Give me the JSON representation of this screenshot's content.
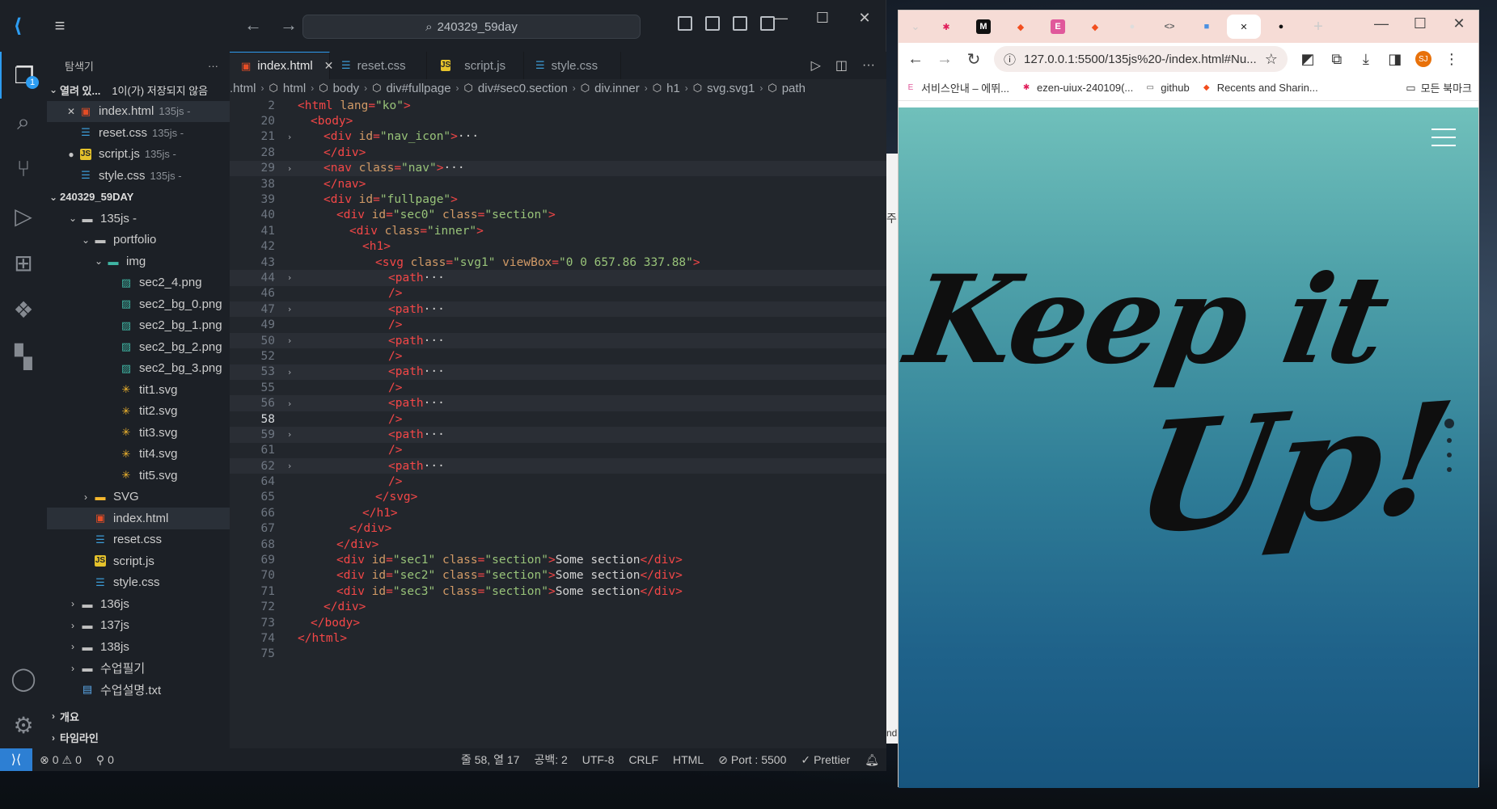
{
  "vscode": {
    "search_text": "240329_59day",
    "explorer_title": "탐색기",
    "explorer_more": "···",
    "open_editors": {
      "label": "열려 있...",
      "unsaved_note": "1이(가) 저장되지 않음",
      "files": [
        {
          "name": "index.html",
          "folder": "135js -",
          "icon": "html"
        },
        {
          "name": "reset.css",
          "folder": "135js -",
          "icon": "css"
        },
        {
          "name": "script.js",
          "folder": "135js -",
          "icon": "js"
        },
        {
          "name": "style.css",
          "folder": "135js -",
          "icon": "css"
        }
      ]
    },
    "workspace": {
      "label": "240329_59DAY",
      "tree": [
        {
          "name": "135js -",
          "type": "folder-open",
          "indent": 1
        },
        {
          "name": "portfolio",
          "type": "folder-open",
          "indent": 2
        },
        {
          "name": "img",
          "type": "img-folder",
          "indent": 3
        },
        {
          "name": "sec2_4.png",
          "type": "img",
          "indent": 4
        },
        {
          "name": "sec2_bg_0.png",
          "type": "img",
          "indent": 4
        },
        {
          "name": "sec2_bg_1.png",
          "type": "img",
          "indent": 4
        },
        {
          "name": "sec2_bg_2.png",
          "type": "img",
          "indent": 4
        },
        {
          "name": "sec2_bg_3.png",
          "type": "img",
          "indent": 4
        },
        {
          "name": "tit1.svg",
          "type": "svg",
          "indent": 4
        },
        {
          "name": "tit2.svg",
          "type": "svg",
          "indent": 4
        },
        {
          "name": "tit3.svg",
          "type": "svg",
          "indent": 4
        },
        {
          "name": "tit4.svg",
          "type": "svg",
          "indent": 4
        },
        {
          "name": "tit5.svg",
          "type": "svg",
          "indent": 4
        },
        {
          "name": "SVG",
          "type": "svg-folder",
          "indent": 2
        },
        {
          "name": "index.html",
          "type": "html",
          "indent": 2
        },
        {
          "name": "reset.css",
          "type": "css",
          "indent": 2
        },
        {
          "name": "script.js",
          "type": "js",
          "indent": 2
        },
        {
          "name": "style.css",
          "type": "css",
          "indent": 2
        },
        {
          "name": "136js",
          "type": "folder",
          "indent": 1
        },
        {
          "name": "137js",
          "type": "folder",
          "indent": 1
        },
        {
          "name": "138js",
          "type": "folder",
          "indent": 1
        },
        {
          "name": "수업필기",
          "type": "folder",
          "indent": 1
        },
        {
          "name": "수업설명.txt",
          "type": "txt",
          "indent": 1
        }
      ]
    },
    "outline_label": "개요",
    "timeline_label": "타임라인",
    "tabs": [
      {
        "label": "index.html",
        "icon": "html",
        "state": "active"
      },
      {
        "label": "reset.css",
        "icon": "css",
        "state": ""
      },
      {
        "label": "script.js",
        "icon": "js",
        "state": "modified"
      },
      {
        "label": "style.css",
        "icon": "css",
        "state": ""
      }
    ],
    "breadcrumb": [
      ".html",
      "html",
      "body",
      "div#fullpage",
      "div#sec0.section",
      "div.inner",
      "h1",
      "svg.svg1",
      "path"
    ],
    "code_lines": [
      {
        "n": "2",
        "fold": "",
        "indent": 0,
        "parts": [
          [
            "t-tag",
            "<html "
          ],
          [
            "t-attr",
            "lang"
          ],
          [
            "t-tag",
            "="
          ],
          [
            "t-str",
            "\"ko\""
          ],
          [
            "t-tag",
            ">"
          ]
        ]
      },
      {
        "n": "20",
        "fold": "",
        "indent": 1,
        "parts": [
          [
            "t-tag",
            "<body>"
          ]
        ]
      },
      {
        "n": "21",
        "fold": ">",
        "indent": 2,
        "parts": [
          [
            "t-tag",
            "<div "
          ],
          [
            "t-attr",
            "id"
          ],
          [
            "t-tag",
            "="
          ],
          [
            "t-str",
            "\"nav_icon\""
          ],
          [
            "t-tag",
            ">"
          ],
          [
            "t-txt",
            "···"
          ]
        ]
      },
      {
        "n": "28",
        "fold": "",
        "indent": 2,
        "parts": [
          [
            "t-tag",
            "</div>"
          ]
        ]
      },
      {
        "n": "29",
        "fold": ">",
        "indent": 2,
        "parts": [
          [
            "t-tag",
            "<nav "
          ],
          [
            "t-attr",
            "class"
          ],
          [
            "t-tag",
            "="
          ],
          [
            "t-str",
            "\"nav\""
          ],
          [
            "t-tag",
            ">"
          ],
          [
            "t-txt",
            "···"
          ]
        ],
        "hl": true
      },
      {
        "n": "38",
        "fold": "",
        "indent": 2,
        "parts": [
          [
            "t-tag",
            "</nav>"
          ]
        ]
      },
      {
        "n": "39",
        "fold": "",
        "indent": 2,
        "parts": [
          [
            "t-tag",
            "<div "
          ],
          [
            "t-attr",
            "id"
          ],
          [
            "t-tag",
            "="
          ],
          [
            "t-str",
            "\"fullpage\""
          ],
          [
            "t-tag",
            ">"
          ]
        ]
      },
      {
        "n": "40",
        "fold": "",
        "indent": 3,
        "parts": [
          [
            "t-tag",
            "<div "
          ],
          [
            "t-attr",
            "id"
          ],
          [
            "t-tag",
            "="
          ],
          [
            "t-str",
            "\"sec0\""
          ],
          [
            "t-txt",
            " "
          ],
          [
            "t-attr",
            "class"
          ],
          [
            "t-tag",
            "="
          ],
          [
            "t-str",
            "\"section\""
          ],
          [
            "t-tag",
            ">"
          ]
        ]
      },
      {
        "n": "41",
        "fold": "",
        "indent": 4,
        "parts": [
          [
            "t-tag",
            "<div "
          ],
          [
            "t-attr",
            "class"
          ],
          [
            "t-tag",
            "="
          ],
          [
            "t-str",
            "\"inner\""
          ],
          [
            "t-tag",
            ">"
          ]
        ]
      },
      {
        "n": "42",
        "fold": "",
        "indent": 5,
        "parts": [
          [
            "t-tag",
            "<h1>"
          ]
        ]
      },
      {
        "n": "43",
        "fold": "",
        "indent": 6,
        "parts": [
          [
            "t-tag",
            "<svg "
          ],
          [
            "t-attr",
            "class"
          ],
          [
            "t-tag",
            "="
          ],
          [
            "t-str",
            "\"svg1\""
          ],
          [
            "t-txt",
            " "
          ],
          [
            "t-attr",
            "viewBox"
          ],
          [
            "t-tag",
            "="
          ],
          [
            "t-str",
            "\"0 0 657.86 337.88\""
          ],
          [
            "t-tag",
            ">"
          ]
        ]
      },
      {
        "n": "44",
        "fold": ">",
        "indent": 7,
        "parts": [
          [
            "t-tag",
            "<path"
          ],
          [
            "t-txt",
            "···"
          ]
        ],
        "hl": true
      },
      {
        "n": "46",
        "fold": "",
        "indent": 7,
        "parts": [
          [
            "t-tag",
            "/>"
          ]
        ]
      },
      {
        "n": "47",
        "fold": ">",
        "indent": 7,
        "parts": [
          [
            "t-tag",
            "<path"
          ],
          [
            "t-txt",
            "···"
          ]
        ],
        "hl": true
      },
      {
        "n": "49",
        "fold": "",
        "indent": 7,
        "parts": [
          [
            "t-tag",
            "/>"
          ]
        ]
      },
      {
        "n": "50",
        "fold": ">",
        "indent": 7,
        "parts": [
          [
            "t-tag",
            "<path"
          ],
          [
            "t-txt",
            "···"
          ]
        ],
        "hl": true
      },
      {
        "n": "52",
        "fold": "",
        "indent": 7,
        "parts": [
          [
            "t-tag",
            "/>"
          ]
        ]
      },
      {
        "n": "53",
        "fold": ">",
        "indent": 7,
        "parts": [
          [
            "t-tag",
            "<path"
          ],
          [
            "t-txt",
            "···"
          ]
        ],
        "hl": true
      },
      {
        "n": "55",
        "fold": "",
        "indent": 7,
        "parts": [
          [
            "t-tag",
            "/>"
          ]
        ]
      },
      {
        "n": "56",
        "fold": ">",
        "indent": 7,
        "parts": [
          [
            "t-tag",
            "<path"
          ],
          [
            "t-txt",
            "···"
          ]
        ],
        "hl": true
      },
      {
        "n": "58",
        "fold": "",
        "indent": 7,
        "parts": [
          [
            "t-tag",
            "/>"
          ]
        ],
        "current": true
      },
      {
        "n": "59",
        "fold": ">",
        "indent": 7,
        "parts": [
          [
            "t-tag",
            "<path"
          ],
          [
            "t-txt",
            "···"
          ]
        ],
        "hl": true
      },
      {
        "n": "61",
        "fold": "",
        "indent": 7,
        "parts": [
          [
            "t-tag",
            "/>"
          ]
        ]
      },
      {
        "n": "62",
        "fold": ">",
        "indent": 7,
        "parts": [
          [
            "t-tag",
            "<path"
          ],
          [
            "t-txt",
            "···"
          ]
        ],
        "hl": true
      },
      {
        "n": "64",
        "fold": "",
        "indent": 7,
        "parts": [
          [
            "t-tag",
            "/>"
          ]
        ]
      },
      {
        "n": "65",
        "fold": "",
        "indent": 6,
        "parts": [
          [
            "t-tag",
            "</svg>"
          ]
        ]
      },
      {
        "n": "66",
        "fold": "",
        "indent": 5,
        "parts": [
          [
            "t-tag",
            "</h1>"
          ]
        ]
      },
      {
        "n": "67",
        "fold": "",
        "indent": 4,
        "parts": [
          [
            "t-tag",
            "</div>"
          ]
        ]
      },
      {
        "n": "68",
        "fold": "",
        "indent": 3,
        "parts": [
          [
            "t-tag",
            "</div>"
          ]
        ]
      },
      {
        "n": "69",
        "fold": "",
        "indent": 3,
        "parts": [
          [
            "t-tag",
            "<div "
          ],
          [
            "t-attr",
            "id"
          ],
          [
            "t-tag",
            "="
          ],
          [
            "t-str",
            "\"sec1\""
          ],
          [
            "t-txt",
            " "
          ],
          [
            "t-attr",
            "class"
          ],
          [
            "t-tag",
            "="
          ],
          [
            "t-str",
            "\"section\""
          ],
          [
            "t-tag",
            ">"
          ],
          [
            "t-txt",
            "Some section"
          ],
          [
            "t-tag",
            "</div>"
          ]
        ]
      },
      {
        "n": "70",
        "fold": "",
        "indent": 3,
        "parts": [
          [
            "t-tag",
            "<div "
          ],
          [
            "t-attr",
            "id"
          ],
          [
            "t-tag",
            "="
          ],
          [
            "t-str",
            "\"sec2\""
          ],
          [
            "t-txt",
            " "
          ],
          [
            "t-attr",
            "class"
          ],
          [
            "t-tag",
            "="
          ],
          [
            "t-str",
            "\"section\""
          ],
          [
            "t-tag",
            ">"
          ],
          [
            "t-txt",
            "Some section"
          ],
          [
            "t-tag",
            "</div>"
          ]
        ]
      },
      {
        "n": "71",
        "fold": "",
        "indent": 3,
        "parts": [
          [
            "t-tag",
            "<div "
          ],
          [
            "t-attr",
            "id"
          ],
          [
            "t-tag",
            "="
          ],
          [
            "t-str",
            "\"sec3\""
          ],
          [
            "t-txt",
            " "
          ],
          [
            "t-attr",
            "class"
          ],
          [
            "t-tag",
            "="
          ],
          [
            "t-str",
            "\"section\""
          ],
          [
            "t-tag",
            ">"
          ],
          [
            "t-txt",
            "Some section"
          ],
          [
            "t-tag",
            "</div>"
          ]
        ]
      },
      {
        "n": "72",
        "fold": "",
        "indent": 2,
        "parts": [
          [
            "t-tag",
            "</div>"
          ]
        ]
      },
      {
        "n": "73",
        "fold": "",
        "indent": 1,
        "parts": [
          [
            "t-tag",
            "</body>"
          ]
        ]
      },
      {
        "n": "74",
        "fold": "",
        "indent": 0,
        "parts": [
          [
            "t-tag",
            "</html>"
          ]
        ]
      },
      {
        "n": "75",
        "fold": "",
        "indent": 0,
        "parts": []
      }
    ],
    "status": {
      "errors": "0",
      "warnings": "0",
      "ports": "0",
      "position": "줄 58, 열 17",
      "spaces": "공백: 2",
      "encoding": "UTF-8",
      "eol": "CRLF",
      "language": "HTML",
      "port": "Port : 5500",
      "formatter": "Prettier"
    },
    "explorer_badge": "1"
  },
  "behind_window": {
    "char_top": "주",
    "char_bottom": "nd"
  },
  "chrome": {
    "tabs": [
      {
        "fav": "slack",
        "label": "✱",
        "color": "#e01e5a",
        "bg": "transparent"
      },
      {
        "fav": "m",
        "label": "M",
        "color": "#ffffff",
        "bg": "#111111"
      },
      {
        "fav": "figma",
        "label": "◆",
        "color": "#f24e1e",
        "bg": "transparent"
      },
      {
        "fav": "e",
        "label": "E",
        "color": "#ffffff",
        "bg": "#e0589b"
      },
      {
        "fav": "figma2",
        "label": "◆",
        "color": "#f24e1e",
        "bg": "transparent"
      },
      {
        "fav": "blank",
        "label": "●",
        "color": "#dddddd",
        "bg": "transparent"
      },
      {
        "fav": "code",
        "label": "<>",
        "color": "#666666",
        "bg": "transparent"
      },
      {
        "fav": "cube",
        "label": "■",
        "color": "#4a90e2",
        "bg": "transparent"
      },
      {
        "fav": "close",
        "label": "✕",
        "color": "#222222",
        "bg": "transparent",
        "active": true
      },
      {
        "fav": "github",
        "label": "●",
        "color": "#111111",
        "bg": "transparent"
      }
    ],
    "new_tab": "+",
    "url": "127.0.0.1:5500/135js%20-/index.html#Nu...",
    "profile_initials": "SJ",
    "bookmarks": [
      {
        "icon": "E",
        "label": "서비스안내 – 에뛰...",
        "color": "#e0589b"
      },
      {
        "icon": "✱",
        "label": "ezen-uiux-240109(...",
        "color": "#e01e5a"
      },
      {
        "icon": "▭",
        "label": "github",
        "color": "#555555"
      },
      {
        "icon": "◆",
        "label": "Recents and Sharin...",
        "color": "#f24e1e"
      }
    ],
    "all_bookmarks": "모든 북마크",
    "page": {
      "line1": "Keep it",
      "line2": "Up!"
    }
  }
}
